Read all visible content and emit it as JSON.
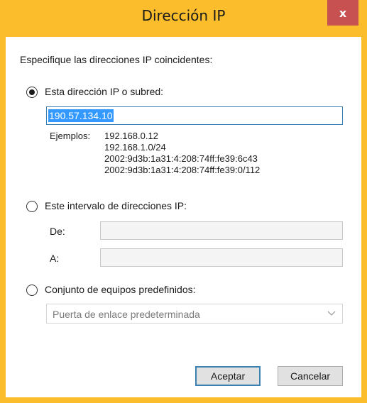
{
  "window": {
    "title": "Dirección IP",
    "close_glyph": "x"
  },
  "dialog": {
    "instruction": "Especifique las direcciones IP coincidentes:",
    "option_single": {
      "label": "Esta dirección IP o subred:",
      "selected": true,
      "value": "190.57.134.10"
    },
    "examples": {
      "label": "Ejemplos:",
      "items": [
        "192.168.0.12",
        "192.168.1.0/24",
        "2002:9d3b:1a31:4:208:74ff:fe39:6c43",
        "2002:9d3b:1a31:4:208:74ff:fe39:0/112"
      ]
    },
    "option_range": {
      "label": "Este intervalo de direcciones IP:",
      "selected": false,
      "from_label": "De:",
      "to_label": "A:",
      "from_value": "",
      "to_value": ""
    },
    "option_predefined": {
      "label": "Conjunto de equipos predefinidos:",
      "selected": false,
      "combo_value": "Puerta de enlace predeterminada"
    },
    "buttons": {
      "ok": "Aceptar",
      "cancel": "Cancelar"
    }
  },
  "icons": {
    "combo_arrow": "chevron-down-icon"
  },
  "colors": {
    "titlebar": "#fbbd2c",
    "close_button": "#c75050",
    "selection": "#3399ff",
    "focus_border": "#3c7fb1"
  }
}
